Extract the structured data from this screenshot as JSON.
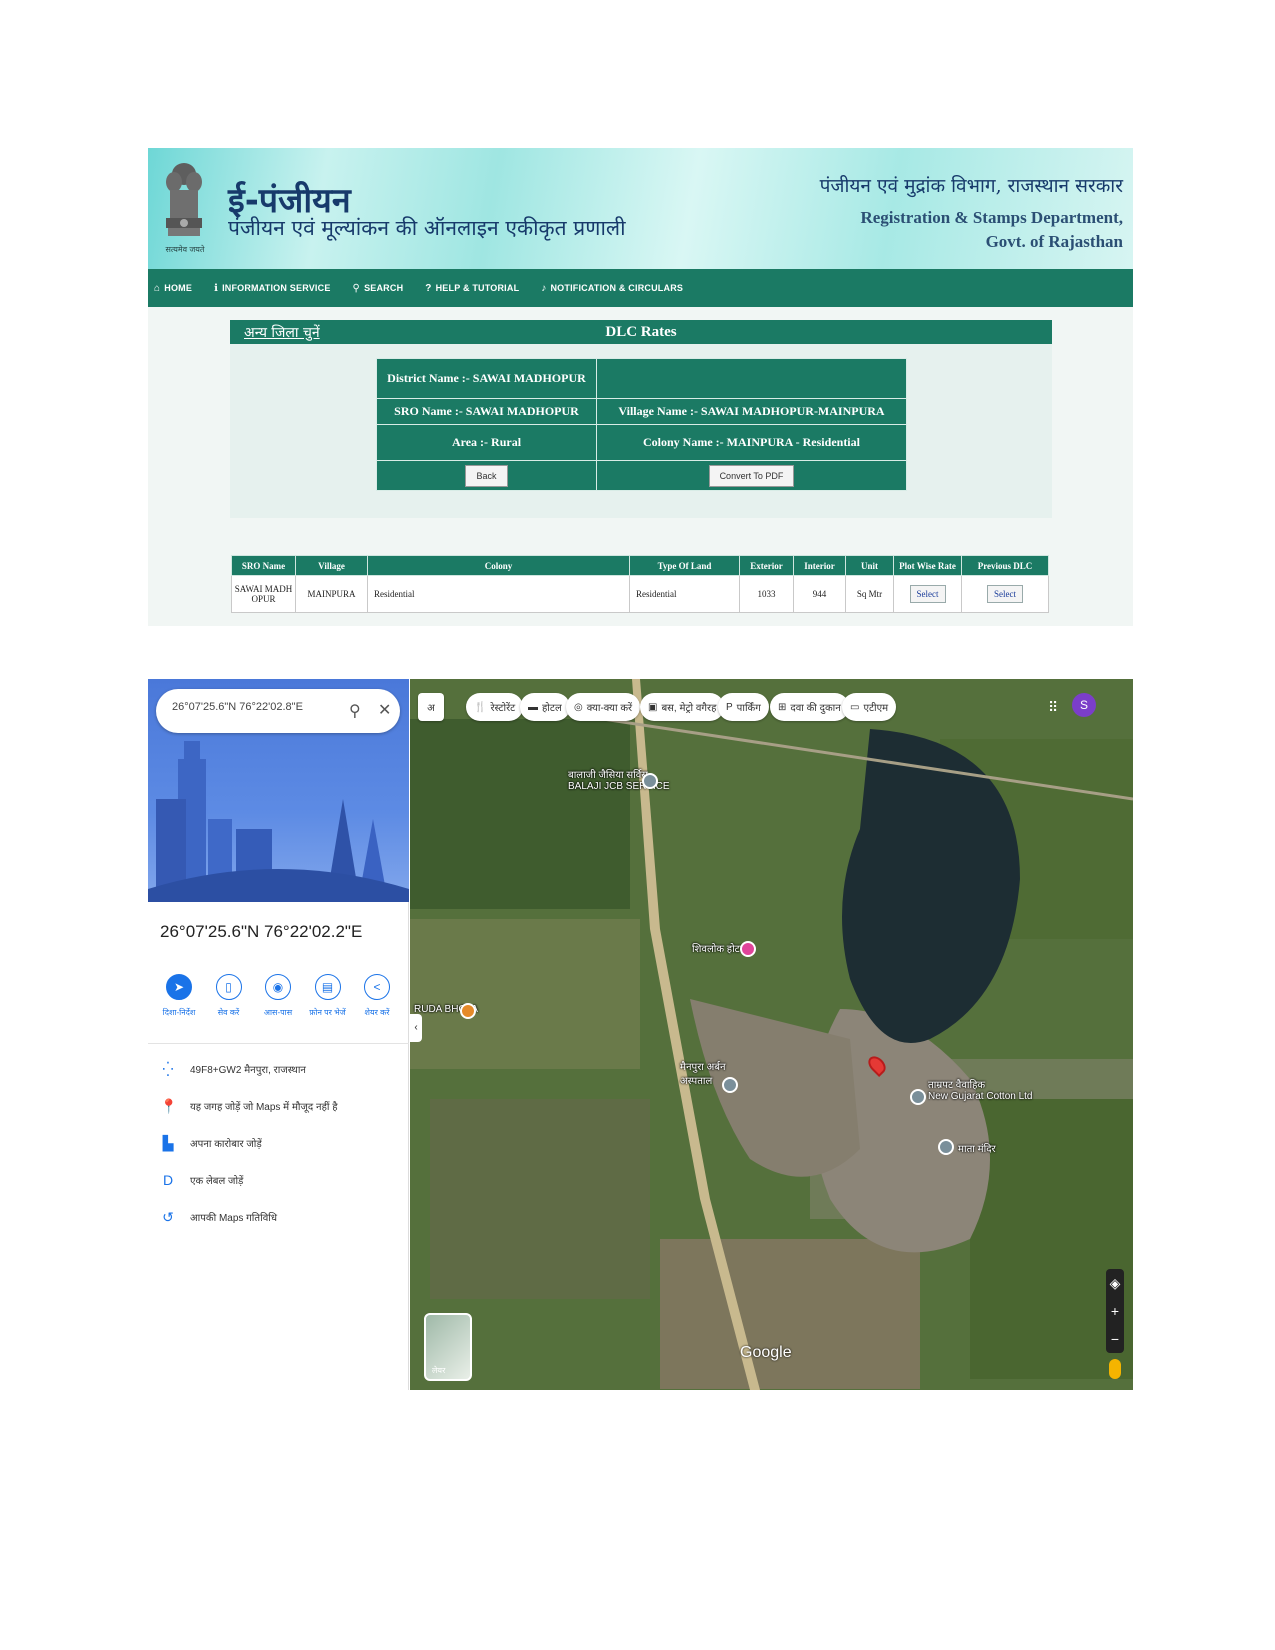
{
  "epanjiyan": {
    "emblem_caption": "सत्यमेव जयते",
    "app_title": "ई-पंजीयन",
    "app_subtitle": "पंजीयन एवं मूल्यांकन की ऑनलाइन एकीकृत प्रणाली",
    "dept_hindi": "पंजीयन एवं मुद्रांक विभाग, राजस्थान सरकार",
    "dept_en_line1": "Registration & Stamps Department,",
    "dept_en_line2": "Govt. of Rajasthan",
    "nav": [
      {
        "label": "HOME",
        "icon": "home-icon"
      },
      {
        "label": "INFORMATION SERVICE",
        "icon": "info-icon"
      },
      {
        "label": "SEARCH",
        "icon": "search-icon"
      },
      {
        "label": "HELP & TUTORIAL",
        "icon": "help-icon"
      },
      {
        "label": "NOTIFICATION & CIRCULARS",
        "icon": "bell-icon"
      }
    ],
    "other_district_link": "अन्य जिला चुनें",
    "panel_title": "DLC Rates",
    "district": "District Name :- SAWAI MADHOPUR",
    "sro": "SRO Name :- SAWAI MADHOPUR",
    "village": "Village Name :- SAWAI MADHOPUR-MAINPURA",
    "area": "Area :- Rural",
    "colony": "Colony Name :- MAINPURA - Residential",
    "back_button": "Back",
    "pdf_button": "Convert To PDF",
    "table": {
      "headers": [
        "SRO Name",
        "Village",
        "Colony",
        "Type Of Land",
        "Exterior",
        "Interior",
        "Unit",
        "Plot Wise Rate",
        "Previous DLC"
      ],
      "row": {
        "sro": "SAWAI MADH OPUR",
        "village": "MAINPURA",
        "colony": "Residential",
        "type": "Residential",
        "exterior": "1033",
        "interior": "944",
        "unit": "Sq Mtr",
        "plot_rate": "Select",
        "previous": "Select"
      }
    },
    "colors": {
      "primary": "#1b7a64",
      "title_blue": "#173a6b"
    }
  },
  "maps": {
    "search_value": "26°07'25.6\"N 76°22'02.8\"E",
    "place_title": "26°07'25.6\"N 76°22'02.2\"E",
    "actions": [
      {
        "label": "दिशा-निर्देश",
        "icon": "directions-icon"
      },
      {
        "label": "सेव करें",
        "icon": "bookmark-icon"
      },
      {
        "label": "आस-पास",
        "icon": "nearby-icon"
      },
      {
        "label": "फ़ोन पर भेजें",
        "icon": "send-to-phone-icon"
      },
      {
        "label": "शेयर करें",
        "icon": "share-icon"
      }
    ],
    "info_rows": [
      {
        "text": "49F8+GW2 मैनपुरा, राजस्थान",
        "icon": "plus-code-icon"
      },
      {
        "text": "यह जगह जोड़ें जो Maps में मौजूद नहीं है",
        "icon": "add-place-icon"
      },
      {
        "text": "अपना कारोबार जोड़ें",
        "icon": "business-icon"
      },
      {
        "text": "एक लेबल जोड़ें",
        "icon": "label-icon"
      },
      {
        "text": "आपकी Maps गतिविधि",
        "icon": "history-icon"
      }
    ],
    "chips": [
      "अ",
      "रेस्टोरेंट",
      "होटल",
      "क्या-क्या करें",
      "बस, मेट्रो वगैरह",
      "पार्किंग",
      "दवा की दुकान",
      "एटीएम"
    ],
    "places": [
      {
        "name": "बालाजी जैसिया सर्विस",
        "sub": "BALAJI JCB SERVICE"
      },
      {
        "name": "शिवलोक होटल"
      },
      {
        "name": "RUDA BHOJA"
      },
      {
        "name": "मैनपुरा अर्बन",
        "sub": "अस्पताल"
      },
      {
        "name": "ताम्रपट वैवाहिक",
        "sub": "New Gujarat Cotton Ltd"
      },
      {
        "name": "माता मंदिर"
      }
    ],
    "avatar_letter": "S",
    "layers_label": "लेयर",
    "google_logo": "Google"
  }
}
